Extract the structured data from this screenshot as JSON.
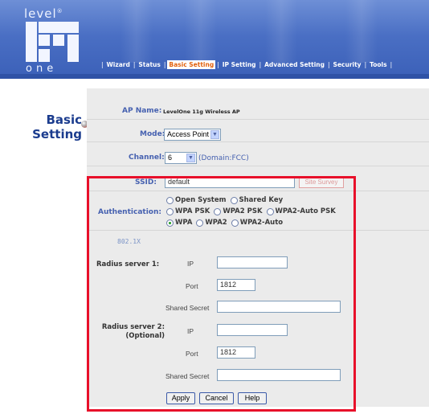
{
  "logo": {
    "top": "level",
    "tm": "®",
    "bottom": "one"
  },
  "nav": {
    "items": [
      "Wizard",
      "Status",
      "Basic Setting",
      "IP Setting",
      "Advanced Setting",
      "Security",
      "Tools"
    ],
    "active_index": 2
  },
  "page": {
    "title_line1": "Basic",
    "title_line2": "Setting"
  },
  "ap_name": {
    "label": "AP Name:",
    "value": "LevelOne 11g Wireless AP"
  },
  "mode": {
    "label": "Mode:",
    "value": "Access Point"
  },
  "channel": {
    "label": "Channel:",
    "value": "6",
    "domain": "(Domain:FCC)"
  },
  "ssid": {
    "label": "SSID:",
    "value": "default",
    "site_survey": "Site Survey"
  },
  "authentication": {
    "label": "Authentication:",
    "row1": [
      "Open System",
      "Shared Key"
    ],
    "row2": [
      "WPA PSK",
      "WPA2 PSK",
      "WPA2-Auto PSK"
    ],
    "row3": [
      "WPA",
      "WPA2",
      "WPA2-Auto"
    ],
    "selected": "WPA"
  },
  "section_8021x": "802.1X",
  "radius1": {
    "label": "Radius server 1:",
    "ip_label": "IP",
    "ip_value": "",
    "port_label": "Port",
    "port_value": "1812",
    "secret_label": "Shared Secret",
    "secret_value": ""
  },
  "radius2": {
    "label_line1": "Radius server 2:",
    "label_line2": "(Optional)",
    "ip_label": "IP",
    "ip_value": "",
    "port_label": "Port",
    "port_value": "1812",
    "secret_label": "Shared Secret",
    "secret_value": ""
  },
  "buttons": {
    "apply": "Apply",
    "cancel": "Cancel",
    "help": "Help"
  },
  "colors": {
    "header_blue": "#4a6fc4",
    "label_blue": "#4661b0",
    "title_navy": "#1b3c8e",
    "highlight_red": "#e8102a",
    "nav_active_orange": "#e2620f"
  }
}
